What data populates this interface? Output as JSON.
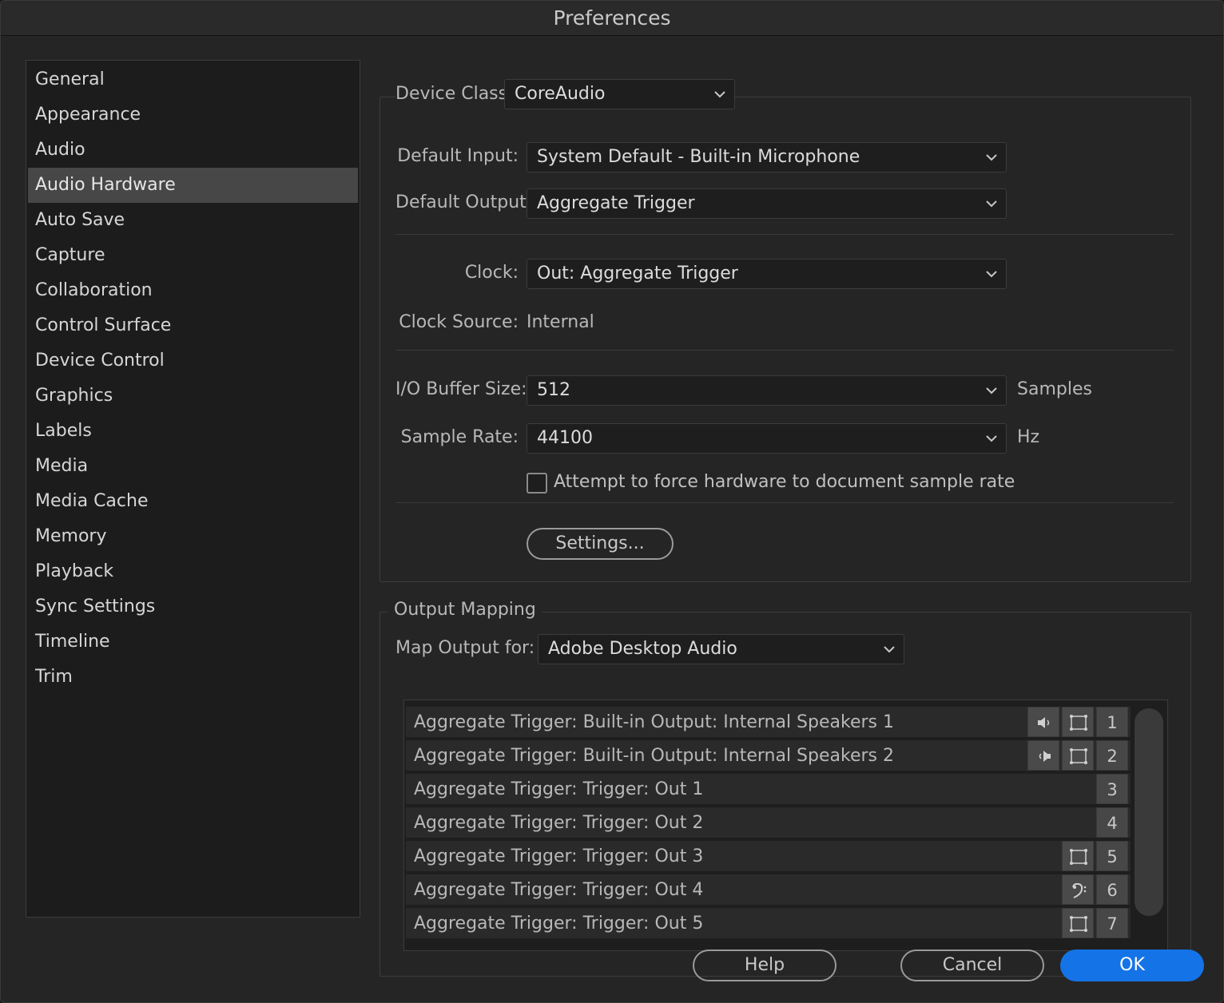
{
  "window": {
    "title": "Preferences"
  },
  "sidebar": {
    "items": [
      {
        "label": "General"
      },
      {
        "label": "Appearance"
      },
      {
        "label": "Audio"
      },
      {
        "label": "Audio Hardware",
        "selected": true
      },
      {
        "label": "Auto Save"
      },
      {
        "label": "Capture"
      },
      {
        "label": "Collaboration"
      },
      {
        "label": "Control Surface"
      },
      {
        "label": "Device Control"
      },
      {
        "label": "Graphics"
      },
      {
        "label": "Labels"
      },
      {
        "label": "Media"
      },
      {
        "label": "Media Cache"
      },
      {
        "label": "Memory"
      },
      {
        "label": "Playback"
      },
      {
        "label": "Sync Settings"
      },
      {
        "label": "Timeline"
      },
      {
        "label": "Trim"
      }
    ]
  },
  "device": {
    "class_label": "Device Class:",
    "class_value": "CoreAudio",
    "default_input_label": "Default Input:",
    "default_input_value": "System Default - Built-in Microphone",
    "default_output_label": "Default Output:",
    "default_output_value": "Aggregate Trigger",
    "clock_label": "Clock:",
    "clock_value": "Out: Aggregate Trigger",
    "clock_source_label": "Clock Source:",
    "clock_source_value": "Internal",
    "buffer_label": "I/O Buffer Size:",
    "buffer_value": "512",
    "buffer_unit": "Samples",
    "sample_rate_label": "Sample Rate:",
    "sample_rate_value": "44100",
    "sample_rate_unit": "Hz",
    "force_rate_label": "Attempt to force hardware to document sample rate",
    "force_rate_checked": false,
    "settings_button": "Settings..."
  },
  "output_mapping": {
    "title": "Output Mapping",
    "map_for_label": "Map Output for:",
    "map_for_value": "Adobe Desktop Audio",
    "rows": [
      {
        "label": "Aggregate Trigger: Built-in Output: Internal Speakers 1",
        "channel": "1",
        "icons": [
          "speaker-left-icon",
          "surround-channel-icon"
        ]
      },
      {
        "label": "Aggregate Trigger: Built-in Output: Internal Speakers 2",
        "channel": "2",
        "icons": [
          "speaker-right-icon",
          "surround-channel-icon"
        ]
      },
      {
        "label": "Aggregate Trigger: Trigger: Out 1",
        "channel": "3",
        "icons": []
      },
      {
        "label": "Aggregate Trigger: Trigger: Out 2",
        "channel": "4",
        "icons": []
      },
      {
        "label": "Aggregate Trigger: Trigger: Out 3",
        "channel": "5",
        "icons": [
          "surround-channel-icon"
        ]
      },
      {
        "label": "Aggregate Trigger: Trigger: Out 4",
        "channel": "6",
        "icons": [
          "bass-clef-icon"
        ]
      },
      {
        "label": "Aggregate Trigger: Trigger: Out 5",
        "channel": "7",
        "icons": [
          "surround-channel-icon"
        ]
      }
    ]
  },
  "footer": {
    "help": "Help",
    "cancel": "Cancel",
    "ok": "OK"
  },
  "colors": {
    "accent": "#1473e6",
    "panel": "#252525",
    "selected": "#474747"
  }
}
